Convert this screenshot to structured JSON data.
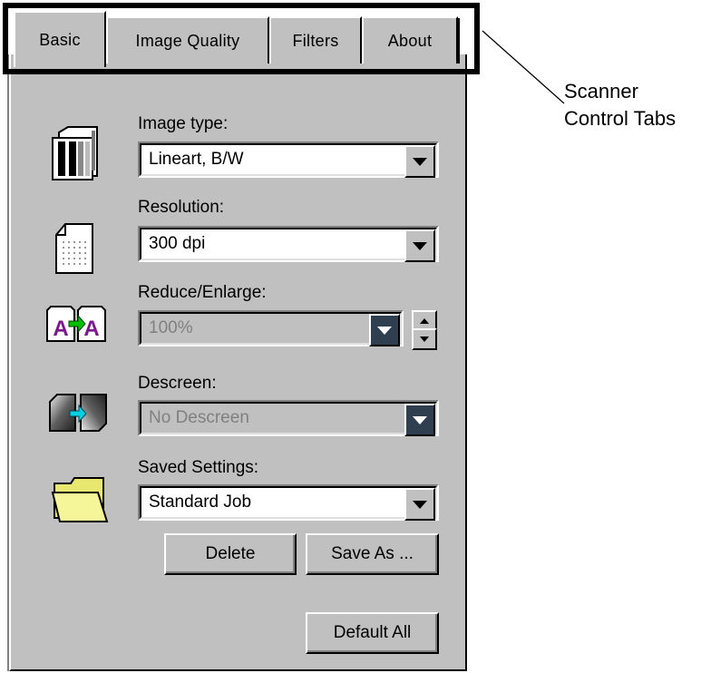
{
  "tabs": [
    {
      "label": "Basic"
    },
    {
      "label": "Image Quality"
    },
    {
      "label": "Filters"
    },
    {
      "label": "About"
    }
  ],
  "fields": {
    "image_type": {
      "label": "Image type:",
      "value": "Lineart, B/W"
    },
    "resolution": {
      "label": "Resolution:",
      "value": "300 dpi"
    },
    "reduce_enlarge": {
      "label": "Reduce/Enlarge:",
      "value": "100%"
    },
    "descreen": {
      "label": "Descreen:",
      "value": "No Descreen"
    },
    "saved_settings": {
      "label": "Saved Settings:",
      "value": "Standard Job"
    }
  },
  "buttons": {
    "delete": "Delete",
    "save_as": "Save As ...",
    "default_all": "Default All"
  },
  "callout": {
    "line1": "Scanner",
    "line2": "Control Tabs"
  },
  "icons": [
    "image-type-icon",
    "resolution-icon",
    "reduce-enlarge-icon",
    "descreen-icon",
    "folder-icon"
  ]
}
